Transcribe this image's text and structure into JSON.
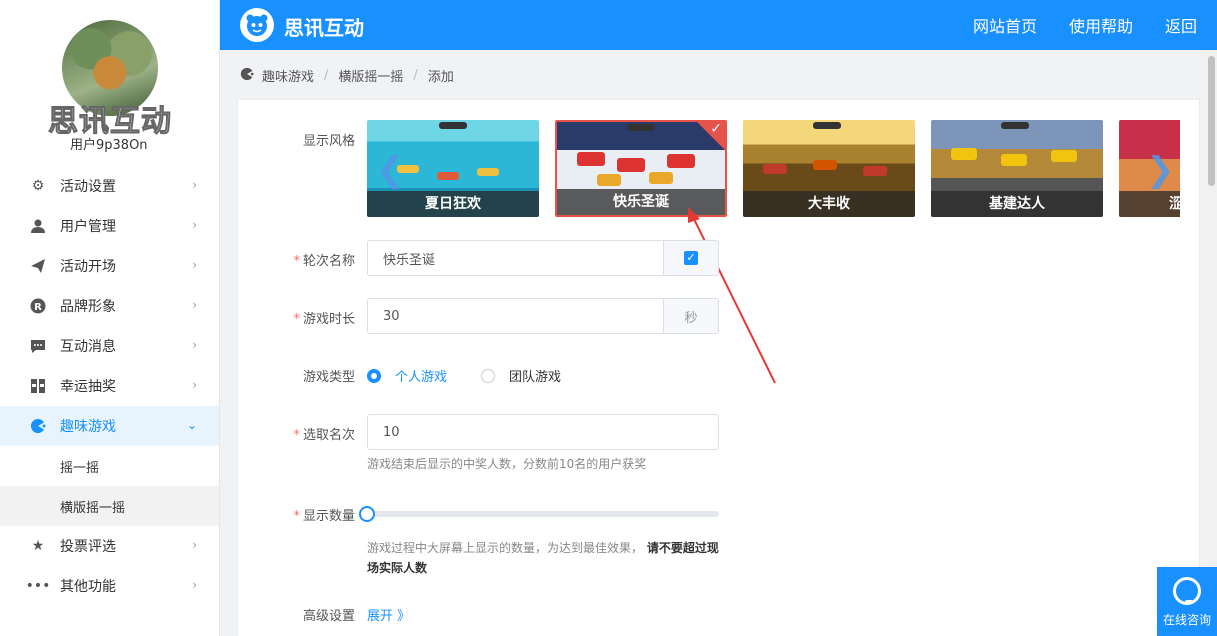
{
  "sidebar": {
    "brand_ghost": "思讯互动",
    "username": "用户9p38On",
    "items": [
      {
        "label": "活动设置",
        "icon": "gears-icon"
      },
      {
        "label": "用户管理",
        "icon": "user-icon"
      },
      {
        "label": "活动开场",
        "icon": "paper-plane-icon"
      },
      {
        "label": "品牌形象",
        "icon": "registered-icon"
      },
      {
        "label": "互动消息",
        "icon": "chat-icon"
      },
      {
        "label": "幸运抽奖",
        "icon": "lottery-icon"
      },
      {
        "label": "趣味游戏",
        "icon": "game-icon",
        "active": true
      },
      {
        "label": "投票评选",
        "icon": "star-icon"
      },
      {
        "label": "其他功能",
        "icon": "more-icon"
      }
    ],
    "sub_items": [
      "摇一摇",
      "横版摇一摇"
    ]
  },
  "header": {
    "logo_text": "思讯互动",
    "nav": [
      "网站首页",
      "使用帮助",
      "返回"
    ]
  },
  "breadcrumb": [
    "趣味游戏",
    "横版摇一摇",
    "添加"
  ],
  "form": {
    "style_label": "显示风格",
    "styles": [
      "夏日狂欢",
      "快乐圣诞",
      "大丰收",
      "基建达人",
      "涩"
    ],
    "selected_style": "快乐圣诞",
    "round_name_label": "轮次名称",
    "round_name_value": "快乐圣诞",
    "duration_label": "游戏时长",
    "duration_value": "30",
    "duration_unit": "秒",
    "type_label": "游戏类型",
    "type_options": [
      "个人游戏",
      "团队游戏"
    ],
    "type_selected": "个人游戏",
    "rank_label": "选取名次",
    "rank_value": "10",
    "rank_hint": "游戏结束后显示的中奖人数，分数前10名的用户获奖",
    "display_label": "显示数量",
    "display_level": 0,
    "display_hint_a": "游戏过程中大屏幕上显示的数量，为达到最佳效果，",
    "display_hint_b": "请不要超过现场实际人数",
    "advanced_label": "高级设置",
    "advanced_link": "展开 》"
  },
  "consult": {
    "label": "在线咨询"
  },
  "colors": {
    "primary": "#1890ff",
    "danger": "#e5534b"
  }
}
